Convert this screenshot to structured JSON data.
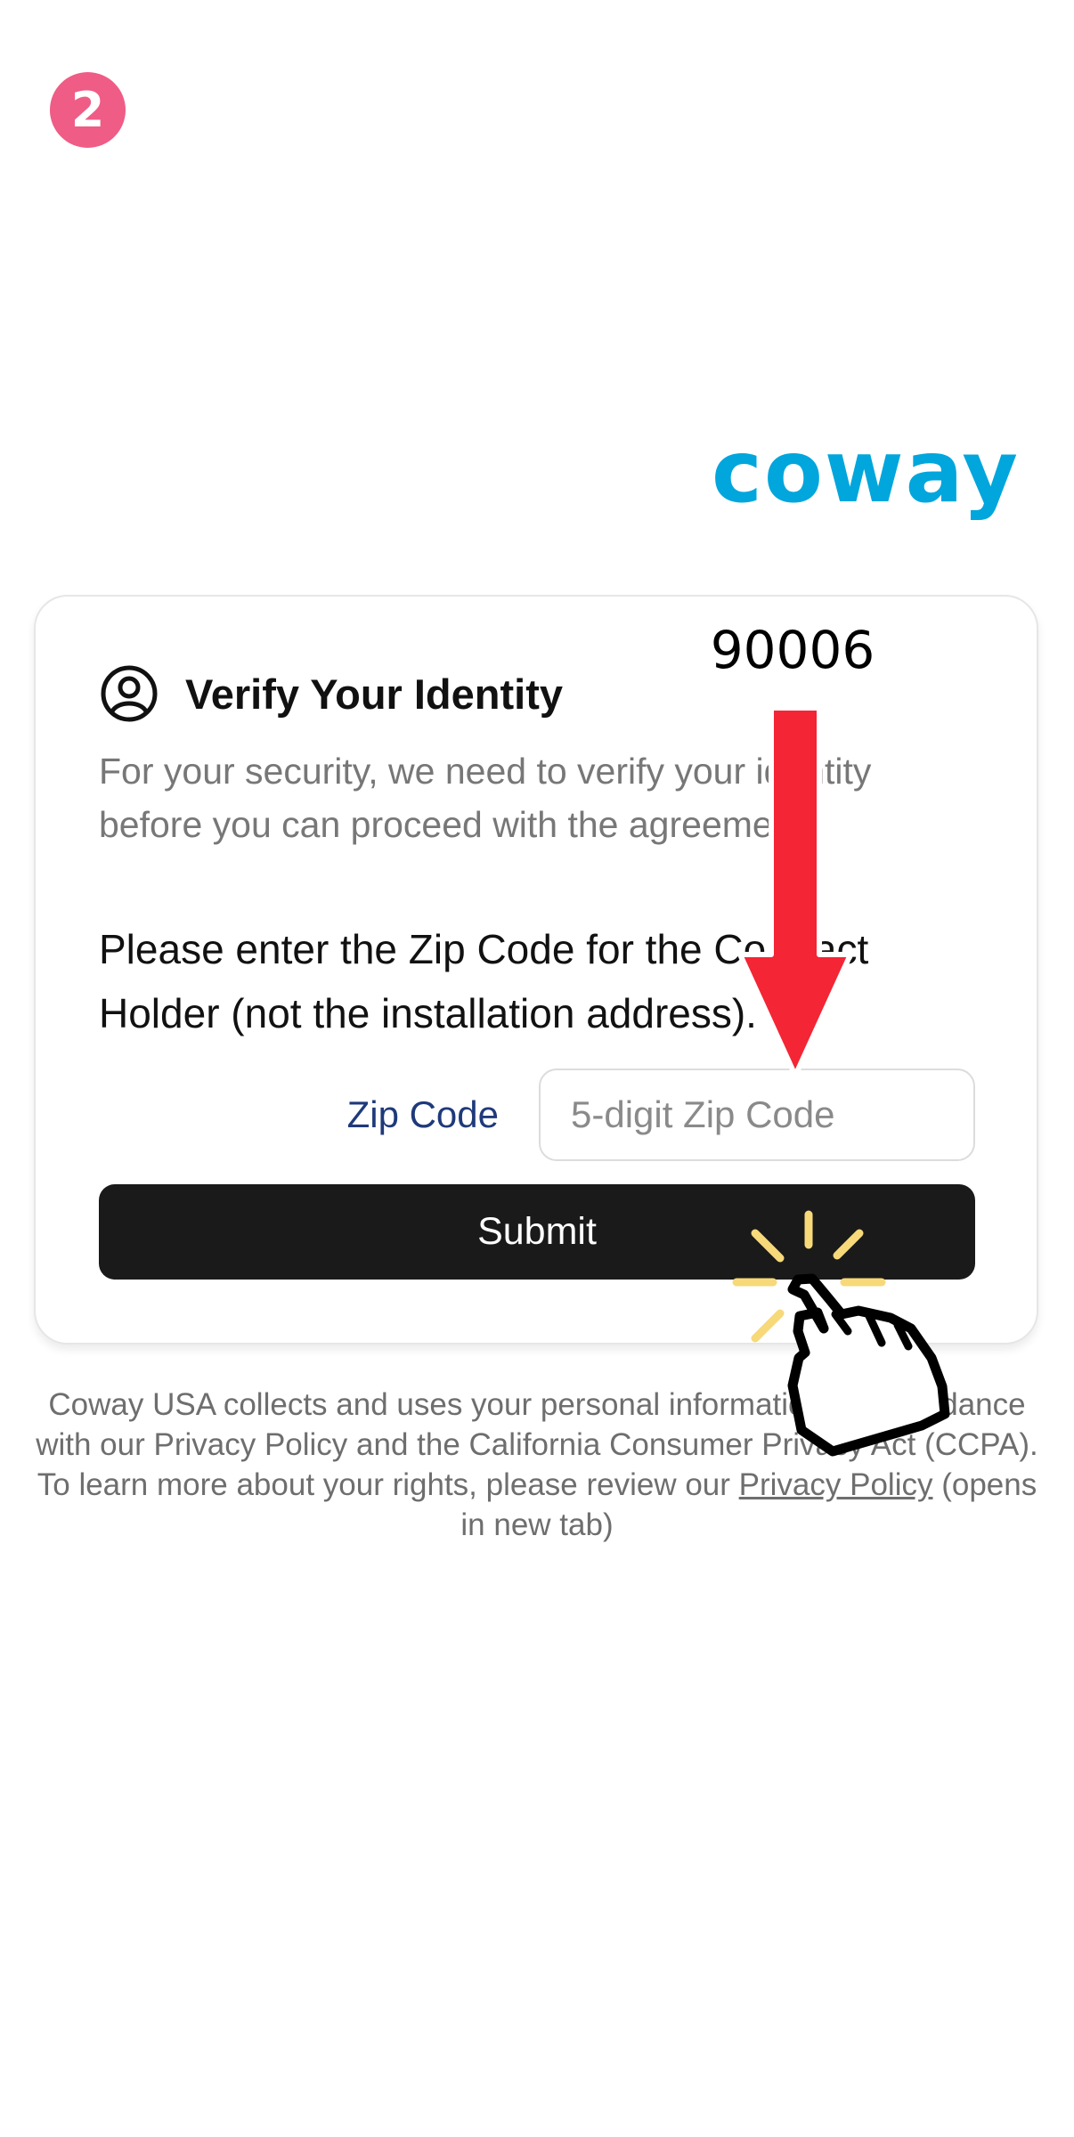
{
  "step_badge": "2",
  "brand": {
    "logo_text": "coway",
    "color": "#00a6dc"
  },
  "card": {
    "title": "Verify Your Identity",
    "title_icon": "user-circle-icon",
    "security_text": "For your security, we need to verify your identity before you can proceed with the agreement.",
    "prompt": "Please enter the Zip Code for the Contract Holder (not the installation address).",
    "zip_label": "Zip Code",
    "zip_input": {
      "placeholder": "5-digit Zip Code",
      "value": ""
    },
    "submit_label": "Submit"
  },
  "footer": {
    "line1": "Coway USA collects and uses your personal information in accordance with our Privacy Policy and the California Consumer Privacy Act (CCPA).",
    "line2_prefix": "To learn more about your rights, please review our ",
    "privacy_link": "Privacy Policy",
    "line2_suffix": " (opens in new tab)"
  },
  "annotation": {
    "entry_value": "90006",
    "arrow_icon": "down-arrow-icon",
    "pointer_icon": "hand-pointer-icon",
    "arrow_color": "#f42534",
    "sparkle_color": "#f7d97a"
  }
}
